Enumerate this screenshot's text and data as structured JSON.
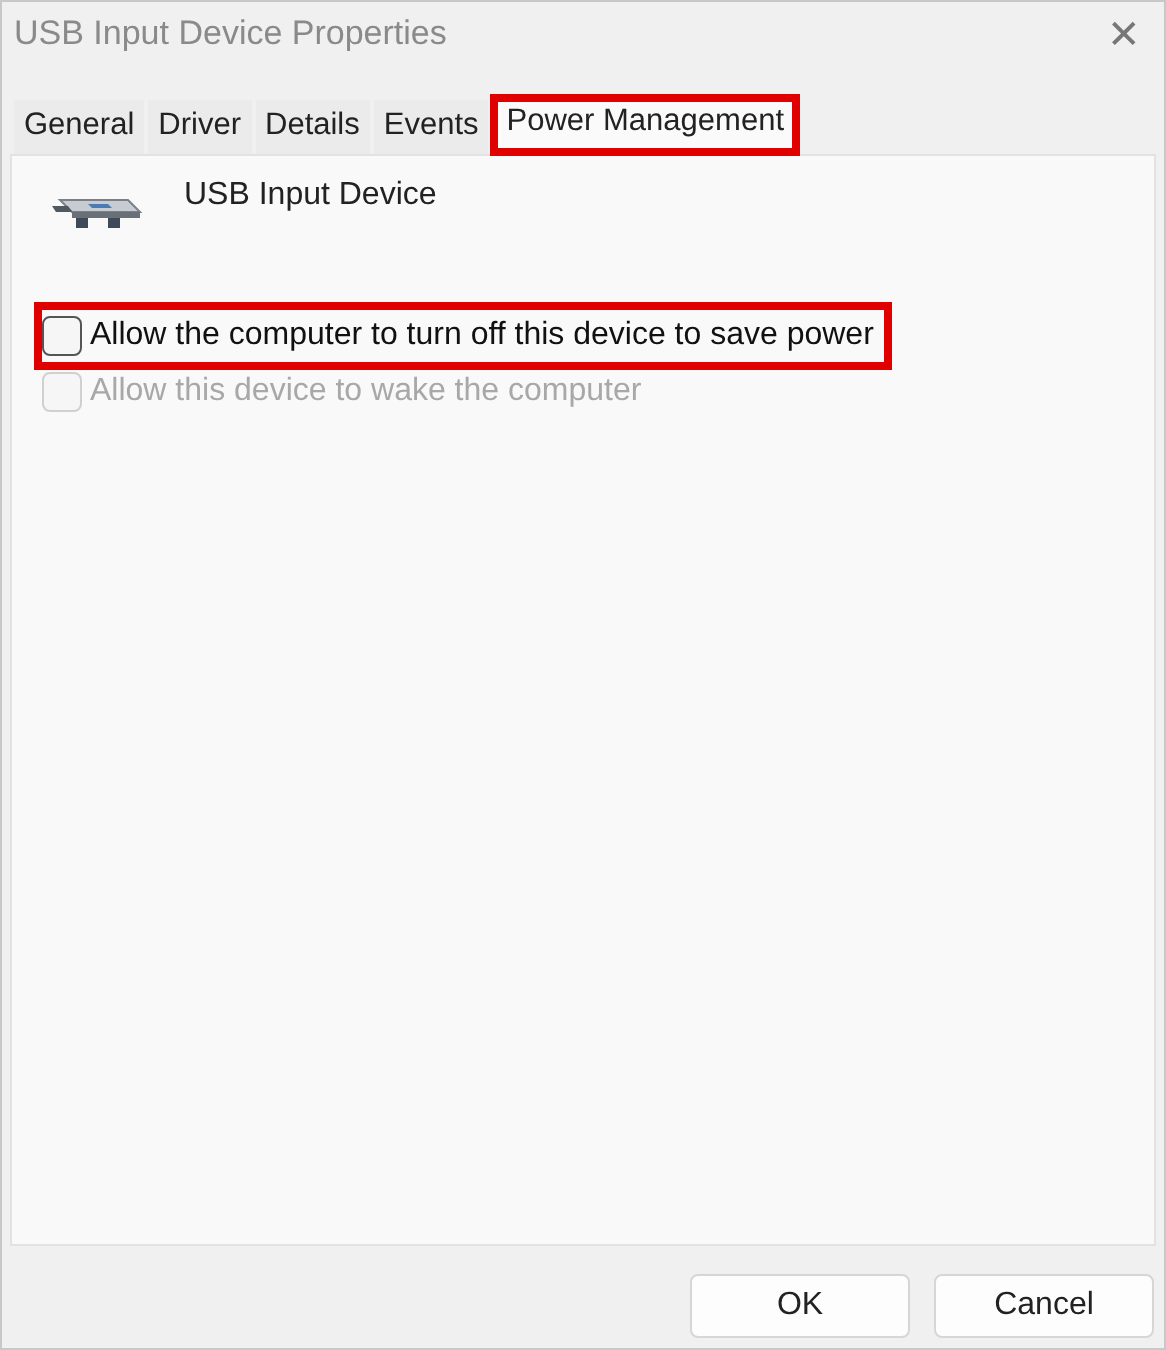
{
  "window": {
    "title": "USB Input Device Properties",
    "close": "✕"
  },
  "tabs": [
    {
      "label": "General",
      "selected": false,
      "highlighted": false
    },
    {
      "label": "Driver",
      "selected": false,
      "highlighted": false
    },
    {
      "label": "Details",
      "selected": false,
      "highlighted": false
    },
    {
      "label": "Events",
      "selected": false,
      "highlighted": false
    },
    {
      "label": "Power Management",
      "selected": true,
      "highlighted": true
    }
  ],
  "device": {
    "name": "USB Input Device"
  },
  "options": [
    {
      "label": "Allow the computer to turn off this device to save power",
      "checked": false,
      "disabled": false,
      "highlighted": true
    },
    {
      "label": "Allow this device to wake the computer",
      "checked": false,
      "disabled": true,
      "highlighted": false
    }
  ],
  "buttons": [
    {
      "label": "OK"
    },
    {
      "label": "Cancel"
    }
  ]
}
